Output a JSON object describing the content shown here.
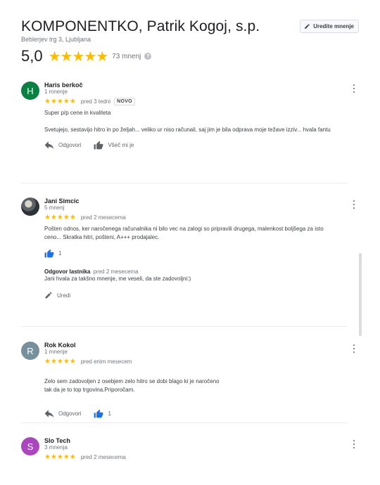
{
  "business": {
    "title": "KOMPONENTKO, Patrik Kogoj, s.p.",
    "address": "Beblerjev trg 3, Ljubljana",
    "rating": "5,0",
    "stars": "★★★★★",
    "review_count": "73 mnenj",
    "edit_button": "Uredite mnenje"
  },
  "reviews": [
    {
      "avatar_letter": "H",
      "avatar_color": "#0b8043",
      "name": "Haris berkoč",
      "sub": "1 mnenje",
      "stars": "★★★★★",
      "date": "pred 3 tedni",
      "badge": "NOVO",
      "text": [
        "Super p/p cene in kvaliteta",
        "Svetujejo, sestavijo hitro in po željah... veliko ur niso računali, saj jim je bila odprava moje težave izziv... hvala fantu"
      ],
      "reply_label": "Odgovori",
      "like_label": "Všeč mi je"
    },
    {
      "avatar_icon": "user-photo",
      "name": "Jani Simcic",
      "sub": "5 mnenj",
      "stars": "★★★★★",
      "date": "pred 2 mesecema",
      "text": [
        "Pošten odnos, ker naročenega računalnika ni bilo vec na zalogi so pripravili drugega, malenkost boljšega za isto ceno... Skratka hitri, pošteni, A+++ prodajalec."
      ],
      "like_count": "1",
      "owner_reply": {
        "title": "Odgovor lastnika",
        "date": "pred 2 mesecema",
        "text": "Jani hvala za takšno mnenje, me veseli, da ste zadovoljni:)"
      },
      "edit_label": "Uredi"
    },
    {
      "avatar_letter": "R",
      "avatar_color": "#78909c",
      "name": "Rok Kokol",
      "sub": "1 mnenje",
      "stars": "★★★★★",
      "date": "pred enim mesecem",
      "text": [
        "Zelo sem zadovoljen z osebjem zelo hitro se dobi blago ki je naročeno\ntak da je to top trgovina.Priporočam."
      ],
      "reply_label": "Odgovori",
      "like_count": "1"
    },
    {
      "avatar_letter": "S",
      "avatar_color": "#ab47bc",
      "name": "Slo Tech",
      "sub": "3 mnenja",
      "stars": "★★★★★",
      "date": "pred 2 mesecema"
    }
  ],
  "colors": {
    "star": "#fbbc04",
    "like_active": "#1a73e8",
    "icon": "#5f6368"
  }
}
